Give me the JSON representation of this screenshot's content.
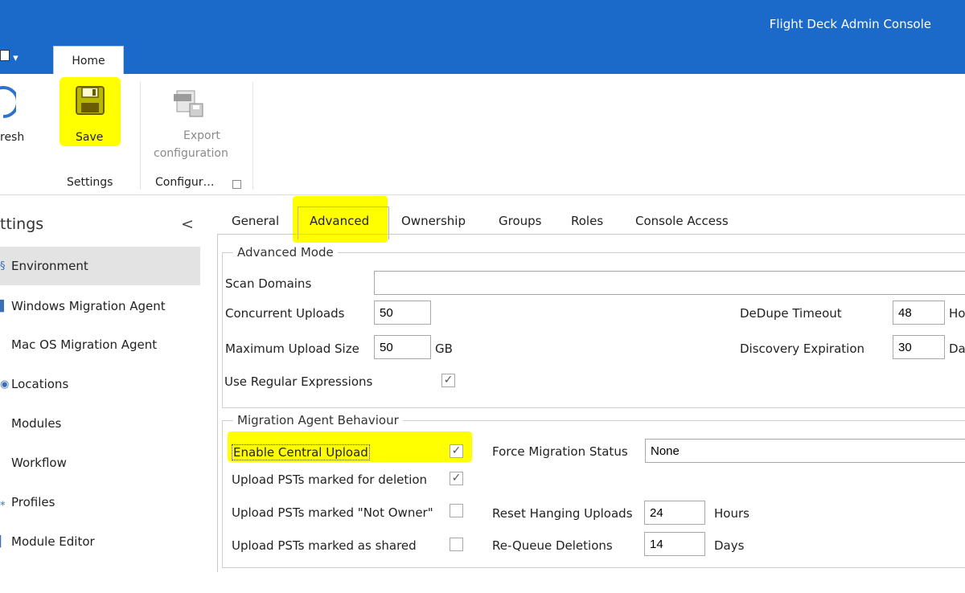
{
  "app": {
    "title": "Flight Deck Admin Console",
    "qat_icon": "menu-icon",
    "qat_arrow": "▾"
  },
  "ribbon": {
    "tab_home": "Home",
    "refresh_label": "resh",
    "save_label": "Save",
    "export_label_1": "Export",
    "export_label_2": "configuration",
    "group_settings": "Settings",
    "group_config": "Configur…"
  },
  "sidebar": {
    "title": "ttings",
    "items": [
      {
        "label": "Environment",
        "icon": "environment-icon",
        "active": true
      },
      {
        "label": "Windows Migration Agent",
        "icon": "windows-icon"
      },
      {
        "label": "Mac OS Migration Agent",
        "icon": "apple-icon"
      },
      {
        "label": "Locations",
        "icon": "location-icon"
      },
      {
        "label": "Modules",
        "icon": "modules-icon"
      },
      {
        "label": "Workflow",
        "icon": "workflow-icon"
      },
      {
        "label": "Profiles",
        "icon": "profiles-icon"
      },
      {
        "label": "Module Editor",
        "icon": "editor-icon"
      }
    ]
  },
  "tabs": [
    "General",
    "Advanced",
    "Ownership",
    "Groups",
    "Roles",
    "Console Access"
  ],
  "advanced_mode": {
    "title": "Advanced Mode",
    "scan_domains_label": "Scan Domains",
    "scan_domains_value": "",
    "concurrent_uploads_label": "Concurrent Uploads",
    "concurrent_uploads_value": "50",
    "max_upload_label": "Maximum Upload Size",
    "max_upload_value": "50",
    "max_upload_unit": "GB",
    "regex_label": "Use Regular Expressions",
    "regex_checked": true,
    "dedupe_label": "DeDupe Timeout",
    "dedupe_value": "48",
    "dedupe_unit": "Ho",
    "discovery_label": "Discovery Expiration",
    "discovery_value": "30",
    "discovery_unit": "Da"
  },
  "migration": {
    "title": "Migration Agent Behaviour",
    "central_upload_label": "Enable Central Upload",
    "central_upload_checked": true,
    "upload_deletion_label": "Upload PSTs marked for deletion",
    "upload_deletion_checked": true,
    "upload_not_owner_label": "Upload PSTs marked \"Not Owner\"",
    "upload_not_owner_checked": false,
    "upload_shared_label": "Upload PSTs marked as shared",
    "upload_shared_checked": false,
    "force_status_label": "Force Migration Status",
    "force_status_value": "None",
    "reset_hanging_label": "Reset Hanging Uploads",
    "reset_hanging_value": "24",
    "reset_hanging_unit": "Hours",
    "requeue_label": "Re-Queue Deletions",
    "requeue_value": "14",
    "requeue_unit": "Days"
  },
  "colors": {
    "titlebar": "#1b6ac9",
    "highlight": "#ffff00",
    "active_item": "#e3e3e3"
  }
}
